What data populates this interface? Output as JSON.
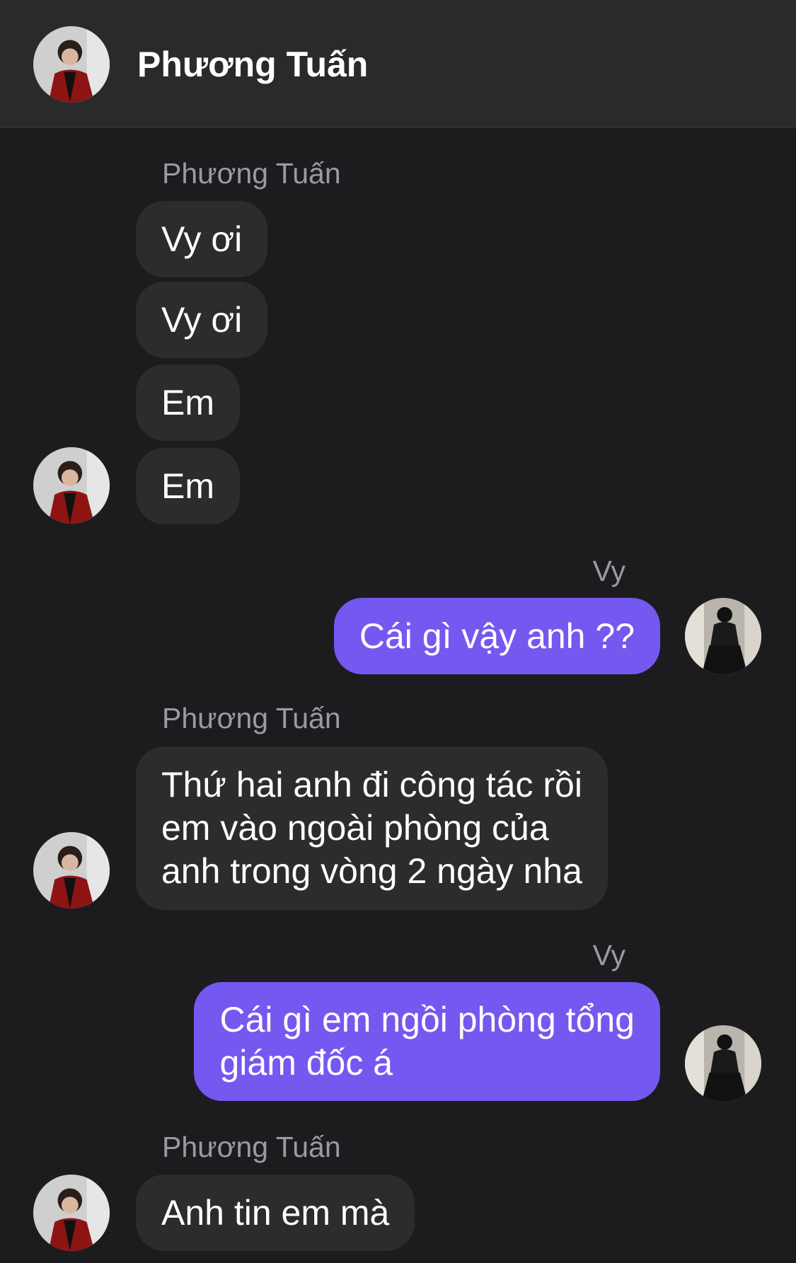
{
  "header": {
    "contact_name": "Phương Tuấn"
  },
  "colors": {
    "background": "#1c1c1f",
    "header": "#2a2a2d",
    "incoming_bubble": "#2c2c2f",
    "outgoing_bubble": "#7458f0",
    "sender_label": "#9a9aa0"
  },
  "messages": [
    {
      "sender": "Phương Tuấn",
      "texts": [
        "Vy ơi",
        "Vy ơi",
        "Em",
        "Em"
      ]
    },
    {
      "sender": "Vy",
      "texts": [
        "Cái gì vậy anh ??"
      ]
    },
    {
      "sender": "Phương Tuấn",
      "texts": [
        "Thứ hai anh đi công tác rồi\nem vào ngoài phòng của\nanh trong vòng 2 ngày nha"
      ]
    },
    {
      "sender": "Vy",
      "texts": [
        "Cái gì em ngồi phòng tổng\ngiám đốc á"
      ]
    },
    {
      "sender": "Phương Tuấn",
      "texts": [
        "Anh tin em mà"
      ]
    }
  ],
  "icons": {
    "contact_avatar": "avatar-tuan",
    "own_avatar": "avatar-vy"
  }
}
